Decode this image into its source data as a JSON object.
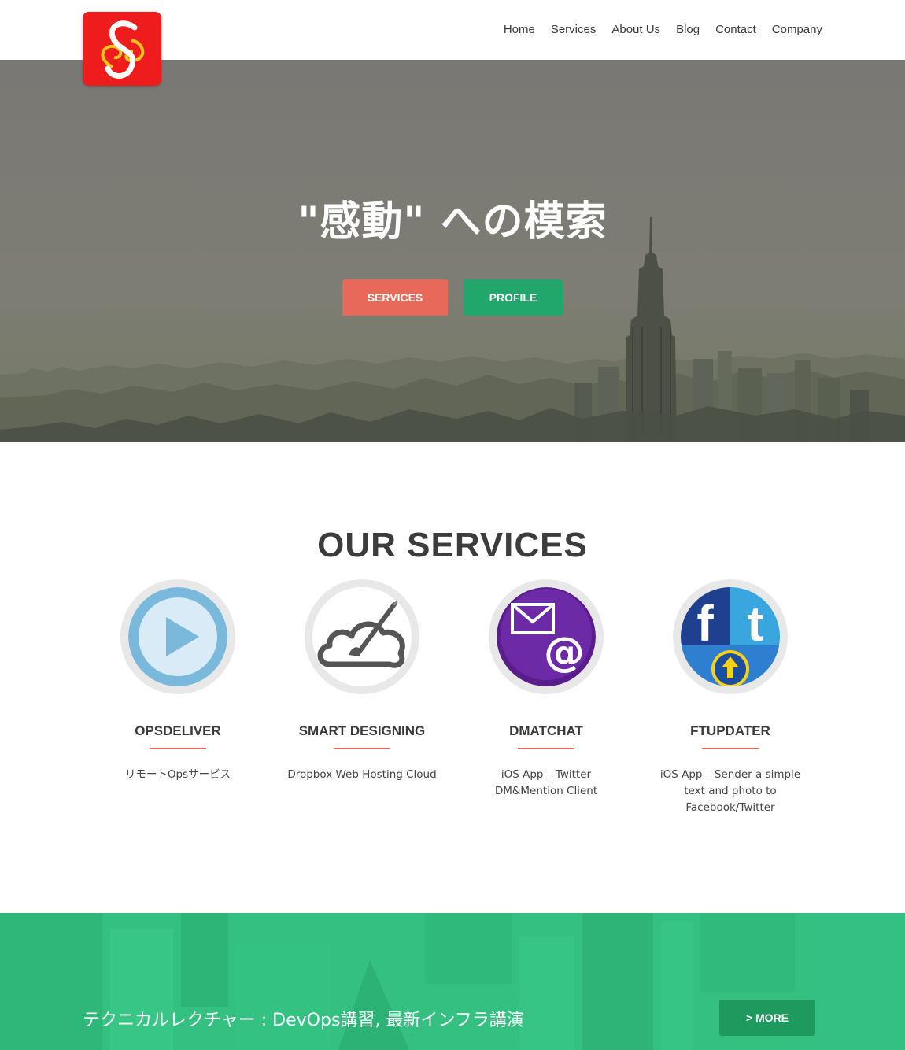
{
  "header": {
    "nav": [
      "Home",
      "Services",
      "About Us",
      "Blog",
      "Contact",
      "Company"
    ]
  },
  "hero": {
    "title": "\"感動\" への模索",
    "buttons": {
      "services": "SERVICES",
      "profile": "PROFILE"
    }
  },
  "services": {
    "heading": "OUR SERVICES",
    "items": [
      {
        "title": "OPSDELIVER",
        "desc": "リモートOpsサービス",
        "icon": "play-icon"
      },
      {
        "title": "SMART DESIGNING",
        "desc": "Dropbox Web Hosting Cloud",
        "icon": "cloud-brush-icon"
      },
      {
        "title": "DMATCHAT",
        "desc": "iOS App – Twitter DM&Mention Client",
        "icon": "mail-at-icon"
      },
      {
        "title": "FTUPDATER",
        "desc": "iOS App – Sender a simple text and photo to Facebook/Twitter",
        "icon": "facebook-twitter-upload-icon"
      }
    ]
  },
  "band": {
    "text": "テクニカルレクチャー : DevOps講習, 最新インフラ講演",
    "more": "> MORE"
  },
  "colors": {
    "accent_red": "#e8685a",
    "accent_green": "#21a66b",
    "logo_red": "#ee1c1c"
  }
}
